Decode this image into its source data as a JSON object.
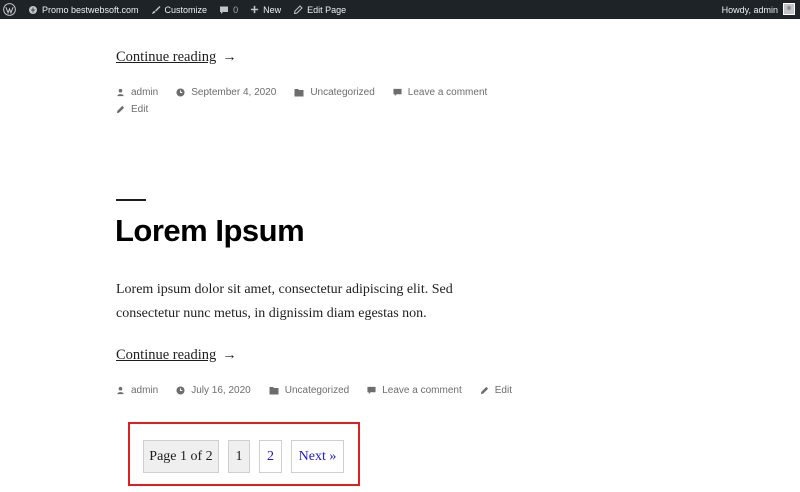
{
  "adminbar": {
    "site_name": "Promo bestwebsoft.com",
    "customize": "Customize",
    "comments_count": "0",
    "new": "New",
    "edit_page": "Edit Page",
    "howdy": "Howdy, admin"
  },
  "colors": {
    "adminbar_bg": "#1d2327",
    "highlight_border": "#e01e1e",
    "link_blue": "#1a1adb"
  },
  "post1": {
    "continue_label": "Continue reading",
    "arrow": "→",
    "author": "admin",
    "date": "September 4, 2020",
    "category": "Uncategorized",
    "comment": "Leave a comment",
    "edit": "Edit"
  },
  "post2": {
    "title": "Lorem Ipsum",
    "excerpt": "Lorem ipsum dolor sit amet, consectetur adipiscing elit. Sed consectetur nunc metus, in dignissim diam egestas non.",
    "continue_label": "Continue reading",
    "arrow": "→",
    "author": "admin",
    "date": "July 16, 2020",
    "category": "Uncategorized",
    "comment": "Leave a comment",
    "edit": "Edit"
  },
  "pagination": {
    "info": "Page 1 of 2",
    "current": "1",
    "page2": "2",
    "next": "Next »"
  }
}
